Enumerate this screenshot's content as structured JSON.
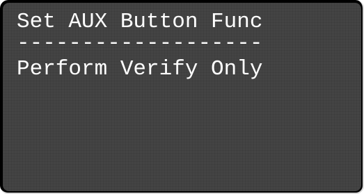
{
  "display": {
    "title": "Set AUX Button Func",
    "separator": "-------------------",
    "option": "Perform Verify Only"
  },
  "colors": {
    "screen_background": "#444444",
    "text": "#ffffff",
    "bezel": "#000000"
  }
}
